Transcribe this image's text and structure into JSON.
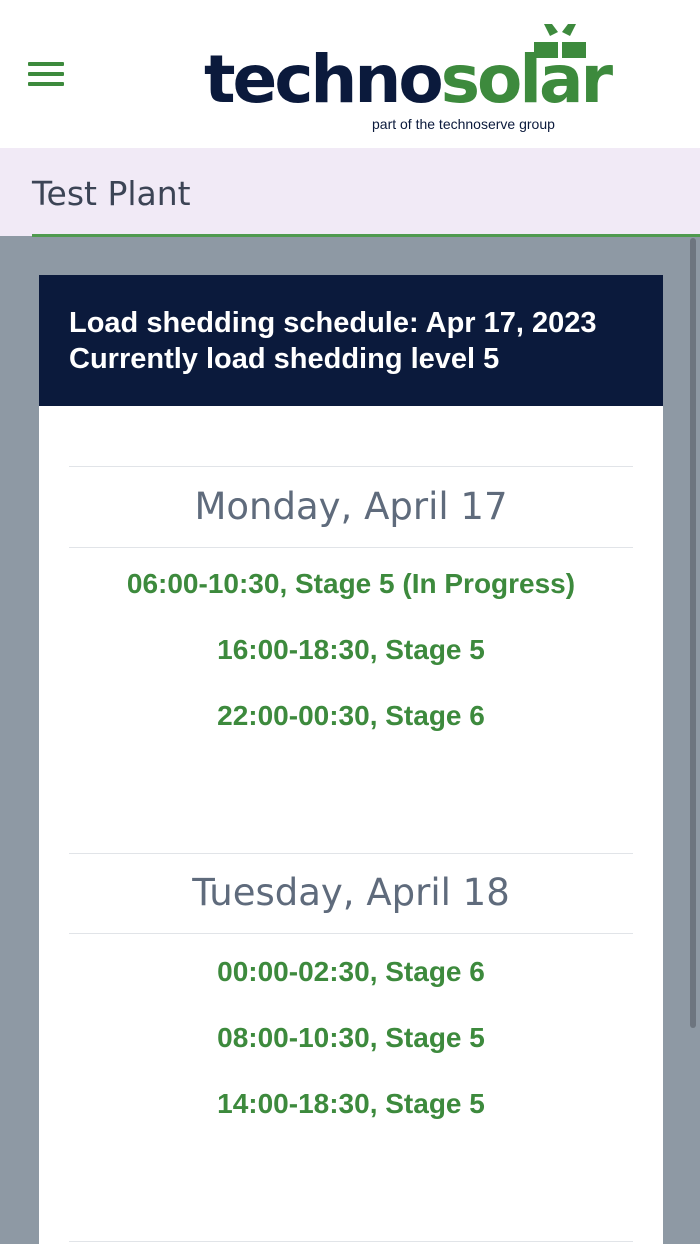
{
  "header": {
    "menu_icon": "hamburger-menu-icon",
    "logo": {
      "text_dark": "techno",
      "text_green": "solar",
      "tagline": "part of the technoserve group",
      "mark_icon": "solar-panel-mark-icon"
    }
  },
  "subheader": {
    "title": "Test Plant"
  },
  "colors": {
    "brand_navy": "#0b1a3c",
    "brand_green": "#3d8a3d",
    "subheader_bg": "#f1eaf6",
    "page_bg": "#8e99a4"
  },
  "schedule": {
    "heading_line1": "Load shedding schedule: Apr 17, 2023",
    "heading_line2": "Currently load shedding level 5",
    "days": [
      {
        "title": "Monday, April 17",
        "slots": [
          "06:00-10:30, Stage 5 (In Progress)",
          "16:00-18:30, Stage 5",
          "22:00-00:30, Stage 6"
        ]
      },
      {
        "title": "Tuesday, April 18",
        "slots": [
          "00:00-02:30, Stage 6",
          "08:00-10:30, Stage 5",
          "14:00-18:30, Stage 5"
        ]
      }
    ]
  }
}
